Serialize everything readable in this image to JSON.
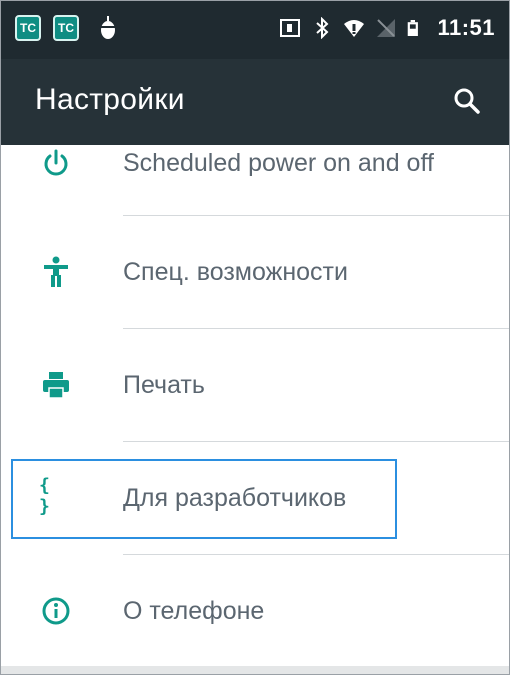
{
  "status_bar": {
    "app_icon_1": "TC",
    "app_icon_2": "TC",
    "time": "11:51",
    "icons": [
      "sim-icon",
      "bluetooth-icon",
      "wifi-icon",
      "no-signal-icon",
      "battery-icon"
    ]
  },
  "app_bar": {
    "title": "Настройки",
    "search_icon": "search-icon"
  },
  "settings": {
    "items": [
      {
        "label": "Scheduled power on and off",
        "icon": "power-icon"
      },
      {
        "label": "Спец. возможности",
        "icon": "accessibility-icon"
      },
      {
        "label": "Печать",
        "icon": "printer-icon"
      },
      {
        "label": "Для разработчиков",
        "icon": "developer-braces-icon",
        "icon_text": "{ }"
      },
      {
        "label": "О телефоне",
        "icon": "info-icon"
      }
    ]
  },
  "colors": {
    "status_bar_bg": "#1f2a30",
    "app_bar_bg": "#263238",
    "icon_accent": "#0f9a8a",
    "label_text": "#5b6670",
    "highlight_border": "#2b8fe0",
    "divider": "#d5d9dc"
  }
}
